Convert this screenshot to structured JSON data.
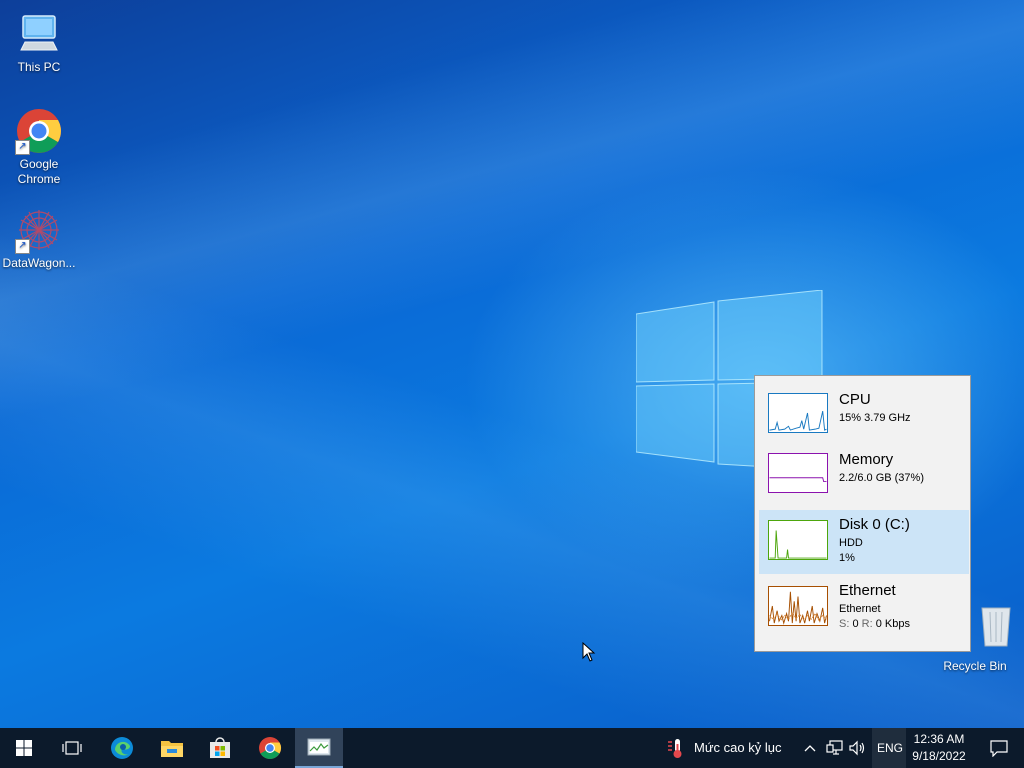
{
  "desktop": {
    "icons": [
      {
        "label": "This PC",
        "icon": "computer-icon"
      },
      {
        "label": "Google Chrome",
        "icon": "chrome-icon"
      },
      {
        "label": "DataWagon...",
        "icon": "datawagon-icon"
      }
    ],
    "recycle_bin": {
      "label": "Recycle Bin",
      "icon": "recycle-bin-icon"
    }
  },
  "performance_flyout": {
    "items": [
      {
        "title": "CPU",
        "sub1": "15%  3.79 GHz",
        "sub2": "",
        "color": "#1979c1"
      },
      {
        "title": "Memory",
        "sub1": "2.2/6.0 GB (37%)",
        "sub2": "",
        "color": "#8b12ae"
      },
      {
        "title": "Disk 0 (C:)",
        "sub1": "HDD",
        "sub2": "1%",
        "color": "#4da60c",
        "selected": true
      },
      {
        "title": "Ethernet",
        "sub1": "Ethernet",
        "sub2": "0",
        "color": "#a74f01"
      }
    ],
    "ethernet": {
      "send_label": "S:",
      "send": "0",
      "recv_label": "R:",
      "recv": "0 Kbps"
    }
  },
  "taskbar": {
    "start": "start-icon",
    "apps": [
      "task-view-icon",
      "edge-icon",
      "file-explorer-icon",
      "store-icon",
      "chrome-icon",
      "task-manager-icon"
    ],
    "weather_text": "Mức cao kỷ lục",
    "language": "ENG",
    "time": "12:36 AM",
    "date": "9/18/2022"
  }
}
